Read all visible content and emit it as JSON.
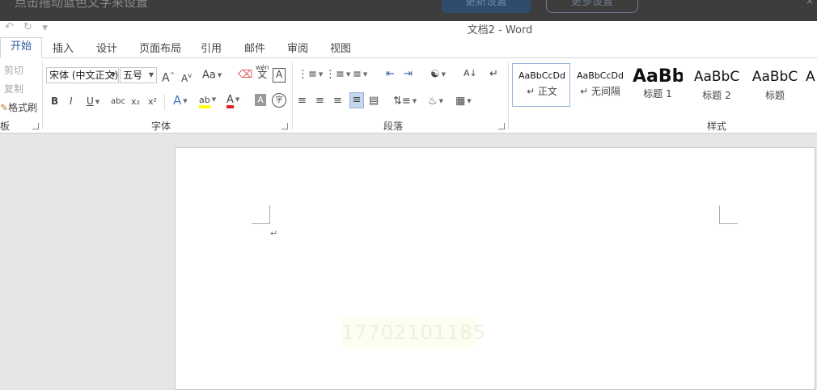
{
  "overlay": {
    "left_text": "点击拖动蓝色文字来设置",
    "button_primary": "更新设置",
    "button_secondary": "更多设置",
    "right_text": "×"
  },
  "titlebar": {
    "undo_icon": "undo-icon",
    "redo_icon": "redo-icon",
    "customize_icon": "customize-qat-icon",
    "title": "文档2 - Word"
  },
  "tabs": [
    "开始",
    "插入",
    "设计",
    "页面布局",
    "引用",
    "邮件",
    "审阅",
    "视图"
  ],
  "active_tab": "开始",
  "clipboard": {
    "cut": "剪切",
    "copy": "复制",
    "format_painter": "格式刷",
    "group_label": "板"
  },
  "font": {
    "font_name": "宋体 (中文正文)",
    "font_size": "五号",
    "grow": "A",
    "shrink": "A",
    "change_case": "Aa",
    "phonetic_top": "wén",
    "phonetic_bottom": "文",
    "char_border": "A",
    "bold": "B",
    "italic": "I",
    "underline": "U",
    "strikethrough": "abc",
    "subscript": "x₂",
    "superscript": "x²",
    "text_effects": "A",
    "highlight": "ab",
    "font_color": "A",
    "char_shading": "A",
    "enclose": "字",
    "group_label": "字体",
    "highlight_color": "#ffff00",
    "font_color_bar": "#e02020"
  },
  "paragraph": {
    "sort": "A↓",
    "show_marks": "↵",
    "group_label": "段落"
  },
  "styles": {
    "items": [
      {
        "preview": "AaBbCcDd",
        "name": "↵ 正文"
      },
      {
        "preview": "AaBbCcDd",
        "name": "↵ 无间隔"
      },
      {
        "preview": "AaBb",
        "name": "标题 1"
      },
      {
        "preview": "AaBbC",
        "name": "标题 2"
      },
      {
        "preview": "AaBbC",
        "name": "标题"
      },
      {
        "preview": "A",
        "name": ""
      }
    ],
    "group_label": "样式"
  },
  "document": {
    "paragraph_mark": "↵",
    "watermark_text": "17702101185"
  }
}
